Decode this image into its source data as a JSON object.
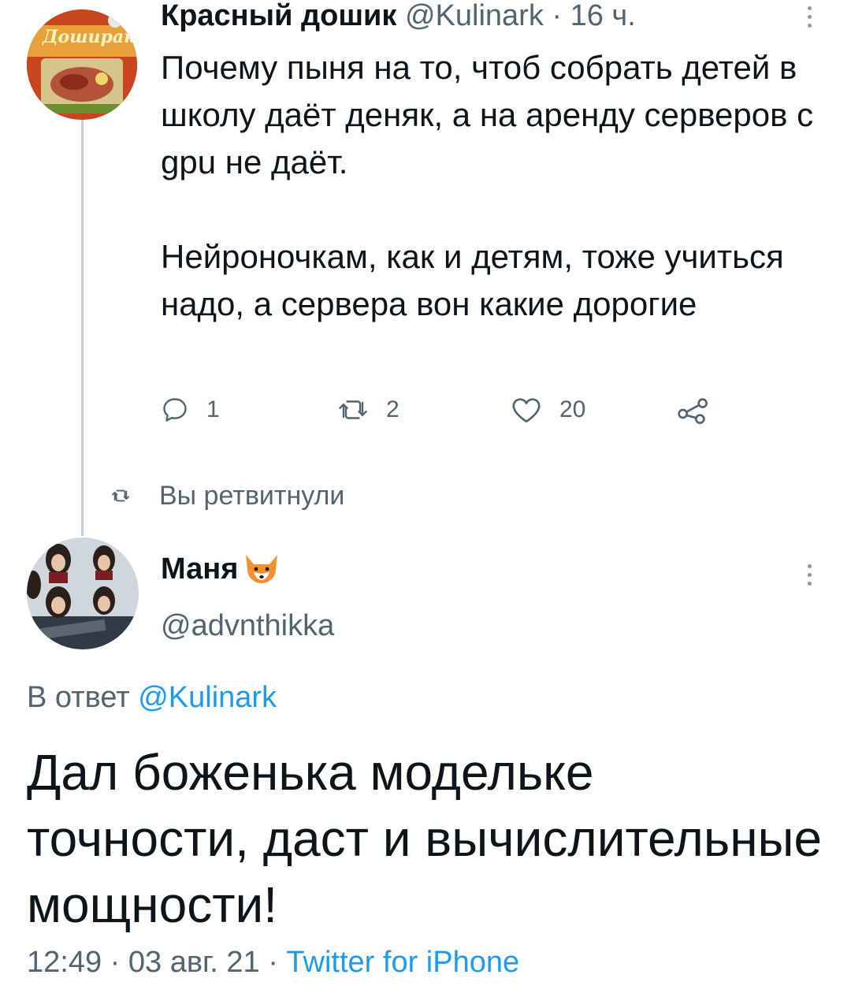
{
  "tweet1": {
    "author_name": "Красный дошик",
    "handle": "@Kulinark",
    "separator": " · ",
    "time": "16 ч.",
    "paragraphs": [
      "Почему пыня на то, чтоб собрать детей в школу даёт деняк, а на аренду серверов с gpu не даёт.",
      "Нейроночкам, как и детям, тоже учиться надо, а сервера вон какие дорогие"
    ],
    "actions": {
      "replies": "1",
      "retweets": "2",
      "likes": "20"
    },
    "retweeted_label": "Вы ретвитнули",
    "avatar_text": "Доширак"
  },
  "tweet2": {
    "author_name": "Маня",
    "name_emoji": "fox-face-emoji",
    "handle": "@advnthikka",
    "reply_prefix": "В ответ ",
    "reply_handle": "@Kulinark",
    "text": "Дал боженька модельке точности, даст и вычислительные мощности!",
    "time": "12:49",
    "separator": " · ",
    "date": "03 авг. 21",
    "source": "Twitter for iPhone"
  },
  "colors": {
    "link": "#1d9bf0",
    "secondary_text": "#536471",
    "primary_text": "#0f1419",
    "thread_line": "#c4cfd6"
  },
  "icons": [
    "reply-icon",
    "retweet-icon",
    "like-icon",
    "share-icon",
    "more-icon"
  ]
}
